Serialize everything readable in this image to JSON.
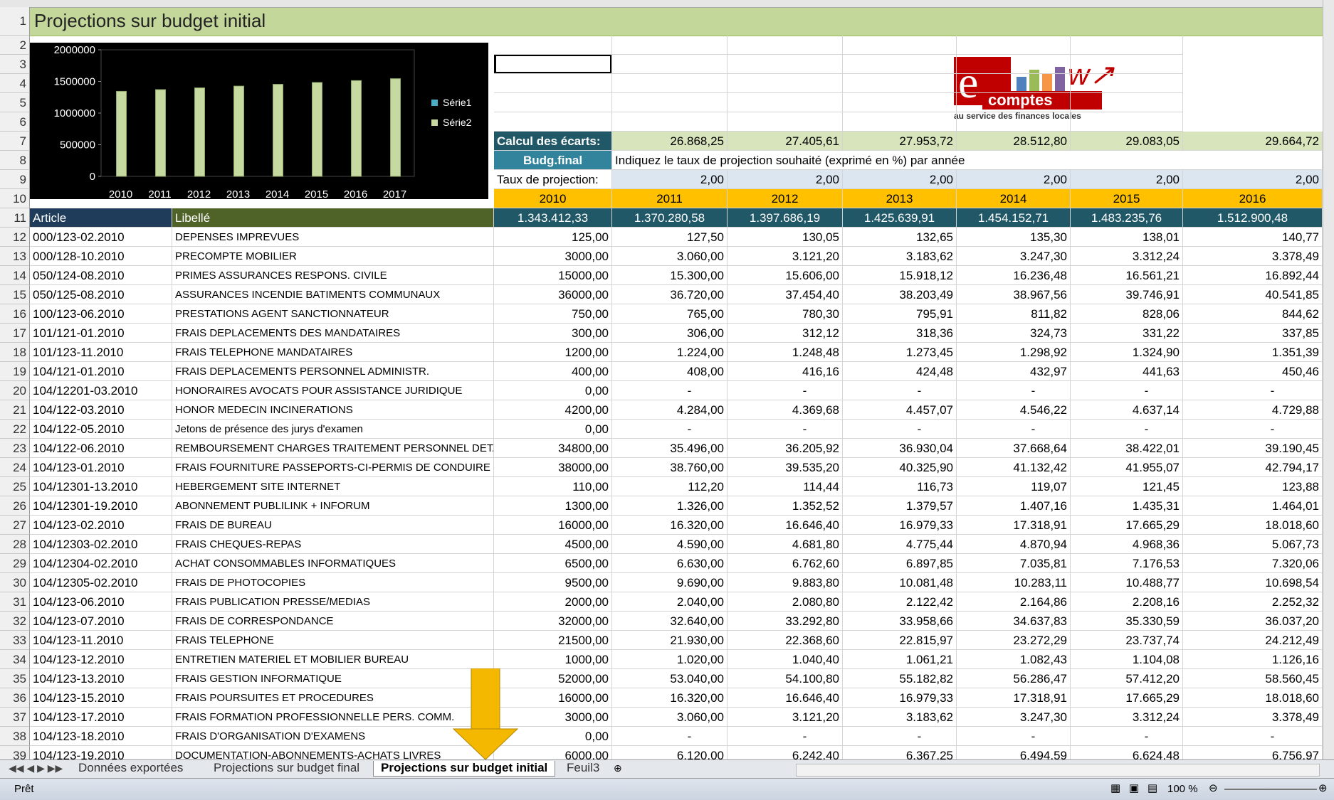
{
  "sheet_title": "Projections sur budget initial",
  "chart_data": {
    "type": "bar",
    "categories": [
      "2010",
      "2011",
      "2012",
      "2013",
      "2014",
      "2015",
      "2016",
      "2017"
    ],
    "series": [
      {
        "name": "Série1",
        "values": [
          0,
          0,
          0,
          0,
          0,
          0,
          0,
          0
        ]
      },
      {
        "name": "Série2",
        "values": [
          1343412,
          1370281,
          1397686,
          1425640,
          1454153,
          1483236,
          1512900,
          1543158
        ]
      }
    ],
    "yticks": [
      "2000000",
      "1500000",
      "1000000",
      "500000",
      "0"
    ],
    "ylim": [
      0,
      2000000
    ],
    "legend": "right"
  },
  "logo": {
    "word": "comptes",
    "tagline": "au service des finances locales"
  },
  "calc": {
    "label": "Calcul des écarts:",
    "values": [
      "26.868,25",
      "27.405,61",
      "27.953,72",
      "28.512,80",
      "29.083,05",
      "29.664,72"
    ]
  },
  "budg": {
    "label": "Budg.final",
    "hint": "Indiquez le taux de projection souhaité (exprimé en %) par année"
  },
  "taux": {
    "label": "Taux de projection:",
    "values": [
      "2,00",
      "2,00",
      "2,00",
      "2,00",
      "2,00",
      "2,00"
    ]
  },
  "years": [
    "2010",
    "2011",
    "2012",
    "2013",
    "2014",
    "2015",
    "2016"
  ],
  "header": {
    "article": "Article",
    "libelle": "Libellé",
    "totals": [
      "1.343.412,33",
      "1.370.280,58",
      "1.397.686,19",
      "1.425.639,91",
      "1.454.152,71",
      "1.483.235,76",
      "1.512.900,48"
    ]
  },
  "rows": [
    {
      "article": "000/123-02.2010",
      "libelle": "DEPENSES IMPREVUES",
      "v": [
        "125,00",
        "127,50",
        "130,05",
        "132,65",
        "135,30",
        "138,01",
        "140,77"
      ]
    },
    {
      "article": "000/128-10.2010",
      "libelle": "PRECOMPTE MOBILIER",
      "v": [
        "3000,00",
        "3.060,00",
        "3.121,20",
        "3.183,62",
        "3.247,30",
        "3.312,24",
        "3.378,49"
      ]
    },
    {
      "article": "050/124-08.2010",
      "libelle": "PRIMES ASSURANCES RESPONS. CIVILE",
      "v": [
        "15000,00",
        "15.300,00",
        "15.606,00",
        "15.918,12",
        "16.236,48",
        "16.561,21",
        "16.892,44"
      ]
    },
    {
      "article": "050/125-08.2010",
      "libelle": "ASSURANCES INCENDIE BATIMENTS COMMUNAUX",
      "v": [
        "36000,00",
        "36.720,00",
        "37.454,40",
        "38.203,49",
        "38.967,56",
        "39.746,91",
        "40.541,85"
      ]
    },
    {
      "article": "100/123-06.2010",
      "libelle": "PRESTATIONS  AGENT SANCTIONNATEUR",
      "v": [
        "750,00",
        "765,00",
        "780,30",
        "795,91",
        "811,82",
        "828,06",
        "844,62"
      ]
    },
    {
      "article": "101/121-01.2010",
      "libelle": "FRAIS DEPLACEMENTS DES MANDATAIRES",
      "v": [
        "300,00",
        "306,00",
        "312,12",
        "318,36",
        "324,73",
        "331,22",
        "337,85"
      ]
    },
    {
      "article": "101/123-11.2010",
      "libelle": "FRAIS TELEPHONE MANDATAIRES",
      "v": [
        "1200,00",
        "1.224,00",
        "1.248,48",
        "1.273,45",
        "1.298,92",
        "1.324,90",
        "1.351,39"
      ]
    },
    {
      "article": "104/121-01.2010",
      "libelle": "FRAIS DEPLACEMENTS PERSONNEL ADMINISTR.",
      "v": [
        "400,00",
        "408,00",
        "416,16",
        "424,48",
        "432,97",
        "441,63",
        "450,46"
      ]
    },
    {
      "article": "104/12201-03.2010",
      "libelle": "HONORAIRES AVOCATS POUR ASSISTANCE JURIDIQUE",
      "v": [
        "0,00",
        "-",
        "-",
        "-",
        "-",
        "-",
        "-"
      ]
    },
    {
      "article": "104/122-03.2010",
      "libelle": "HONOR MEDECIN INCINERATIONS",
      "v": [
        "4200,00",
        "4.284,00",
        "4.369,68",
        "4.457,07",
        "4.546,22",
        "4.637,14",
        "4.729,88"
      ]
    },
    {
      "article": "104/122-05.2010",
      "libelle": "Jetons de présence des jurys d'examen",
      "v": [
        "0,00",
        "-",
        "-",
        "-",
        "-",
        "-",
        "-"
      ]
    },
    {
      "article": "104/122-06.2010",
      "libelle": "REMBOURSEMENT CHARGES TRAITEMENT PERSONNEL DETACHE P",
      "v": [
        "34800,00",
        "35.496,00",
        "36.205,92",
        "36.930,04",
        "37.668,64",
        "38.422,01",
        "39.190,45"
      ]
    },
    {
      "article": "104/123-01.2010",
      "libelle": "FRAIS FOURNITURE PASSEPORTS-CI-PERMIS DE CONDUIRE",
      "v": [
        "38000,00",
        "38.760,00",
        "39.535,20",
        "40.325,90",
        "41.132,42",
        "41.955,07",
        "42.794,17"
      ]
    },
    {
      "article": "104/12301-13.2010",
      "libelle": "HEBERGEMENT SITE INTERNET",
      "v": [
        "110,00",
        "112,20",
        "114,44",
        "116,73",
        "119,07",
        "121,45",
        "123,88"
      ]
    },
    {
      "article": "104/12301-19.2010",
      "libelle": "ABONNEMENT PUBLILINK + INFORUM",
      "v": [
        "1300,00",
        "1.326,00",
        "1.352,52",
        "1.379,57",
        "1.407,16",
        "1.435,31",
        "1.464,01"
      ]
    },
    {
      "article": "104/123-02.2010",
      "libelle": "FRAIS DE BUREAU",
      "v": [
        "16000,00",
        "16.320,00",
        "16.646,40",
        "16.979,33",
        "17.318,91",
        "17.665,29",
        "18.018,60"
      ]
    },
    {
      "article": "104/12303-02.2010",
      "libelle": "FRAIS CHEQUES-REPAS",
      "v": [
        "4500,00",
        "4.590,00",
        "4.681,80",
        "4.775,44",
        "4.870,94",
        "4.968,36",
        "5.067,73"
      ]
    },
    {
      "article": "104/12304-02.2010",
      "libelle": "ACHAT CONSOMMABLES INFORMATIQUES",
      "v": [
        "6500,00",
        "6.630,00",
        "6.762,60",
        "6.897,85",
        "7.035,81",
        "7.176,53",
        "7.320,06"
      ]
    },
    {
      "article": "104/12305-02.2010",
      "libelle": "FRAIS DE PHOTOCOPIES",
      "v": [
        "9500,00",
        "9.690,00",
        "9.883,80",
        "10.081,48",
        "10.283,11",
        "10.488,77",
        "10.698,54"
      ]
    },
    {
      "article": "104/123-06.2010",
      "libelle": "FRAIS PUBLICATION PRESSE/MEDIAS",
      "v": [
        "2000,00",
        "2.040,00",
        "2.080,80",
        "2.122,42",
        "2.164,86",
        "2.208,16",
        "2.252,32"
      ]
    },
    {
      "article": "104/123-07.2010",
      "libelle": "FRAIS DE CORRESPONDANCE",
      "v": [
        "32000,00",
        "32.640,00",
        "33.292,80",
        "33.958,66",
        "34.637,83",
        "35.330,59",
        "36.037,20"
      ]
    },
    {
      "article": "104/123-11.2010",
      "libelle": "FRAIS TELEPHONE",
      "v": [
        "21500,00",
        "21.930,00",
        "22.368,60",
        "22.815,97",
        "23.272,29",
        "23.737,74",
        "24.212,49"
      ]
    },
    {
      "article": "104/123-12.2010",
      "libelle": "ENTRETIEN MATERIEL ET MOBILIER BUREAU",
      "v": [
        "1000,00",
        "1.020,00",
        "1.040,40",
        "1.061,21",
        "1.082,43",
        "1.104,08",
        "1.126,16"
      ]
    },
    {
      "article": "104/123-13.2010",
      "libelle": "FRAIS GESTION INFORMATIQUE",
      "v": [
        "52000,00",
        "53.040,00",
        "54.100,80",
        "55.182,82",
        "56.286,47",
        "57.412,20",
        "58.560,45"
      ]
    },
    {
      "article": "104/123-15.2010",
      "libelle": "FRAIS POURSUITES ET PROCEDURES",
      "v": [
        "16000,00",
        "16.320,00",
        "16.646,40",
        "16.979,33",
        "17.318,91",
        "17.665,29",
        "18.018,60"
      ]
    },
    {
      "article": "104/123-17.2010",
      "libelle": "FRAIS FORMATION PROFESSIONNELLE PERS. COMM.",
      "v": [
        "3000,00",
        "3.060,00",
        "3.121,20",
        "3.183,62",
        "3.247,30",
        "3.312,24",
        "3.378,49"
      ]
    },
    {
      "article": "104/123-18.2010",
      "libelle": "FRAIS D'ORGANISATION D'EXAMENS",
      "v": [
        "0,00",
        "-",
        "-",
        "-",
        "-",
        "-",
        "-"
      ]
    },
    {
      "article": "104/123-19.2010",
      "libelle": "DOCUMENTATION-ABONNEMENTS-ACHATS LIVRES",
      "v": [
        "6000,00",
        "6.120,00",
        "6.242,40",
        "6.367,25",
        "6.494,59",
        "6.624,48",
        "6.756,97"
      ]
    }
  ],
  "tabs": [
    "Données exportées",
    "Projections sur budget final",
    "Projections sur budget initial",
    "Feuil3"
  ],
  "status": {
    "ready": "Prêt",
    "zoom": "100 %"
  }
}
